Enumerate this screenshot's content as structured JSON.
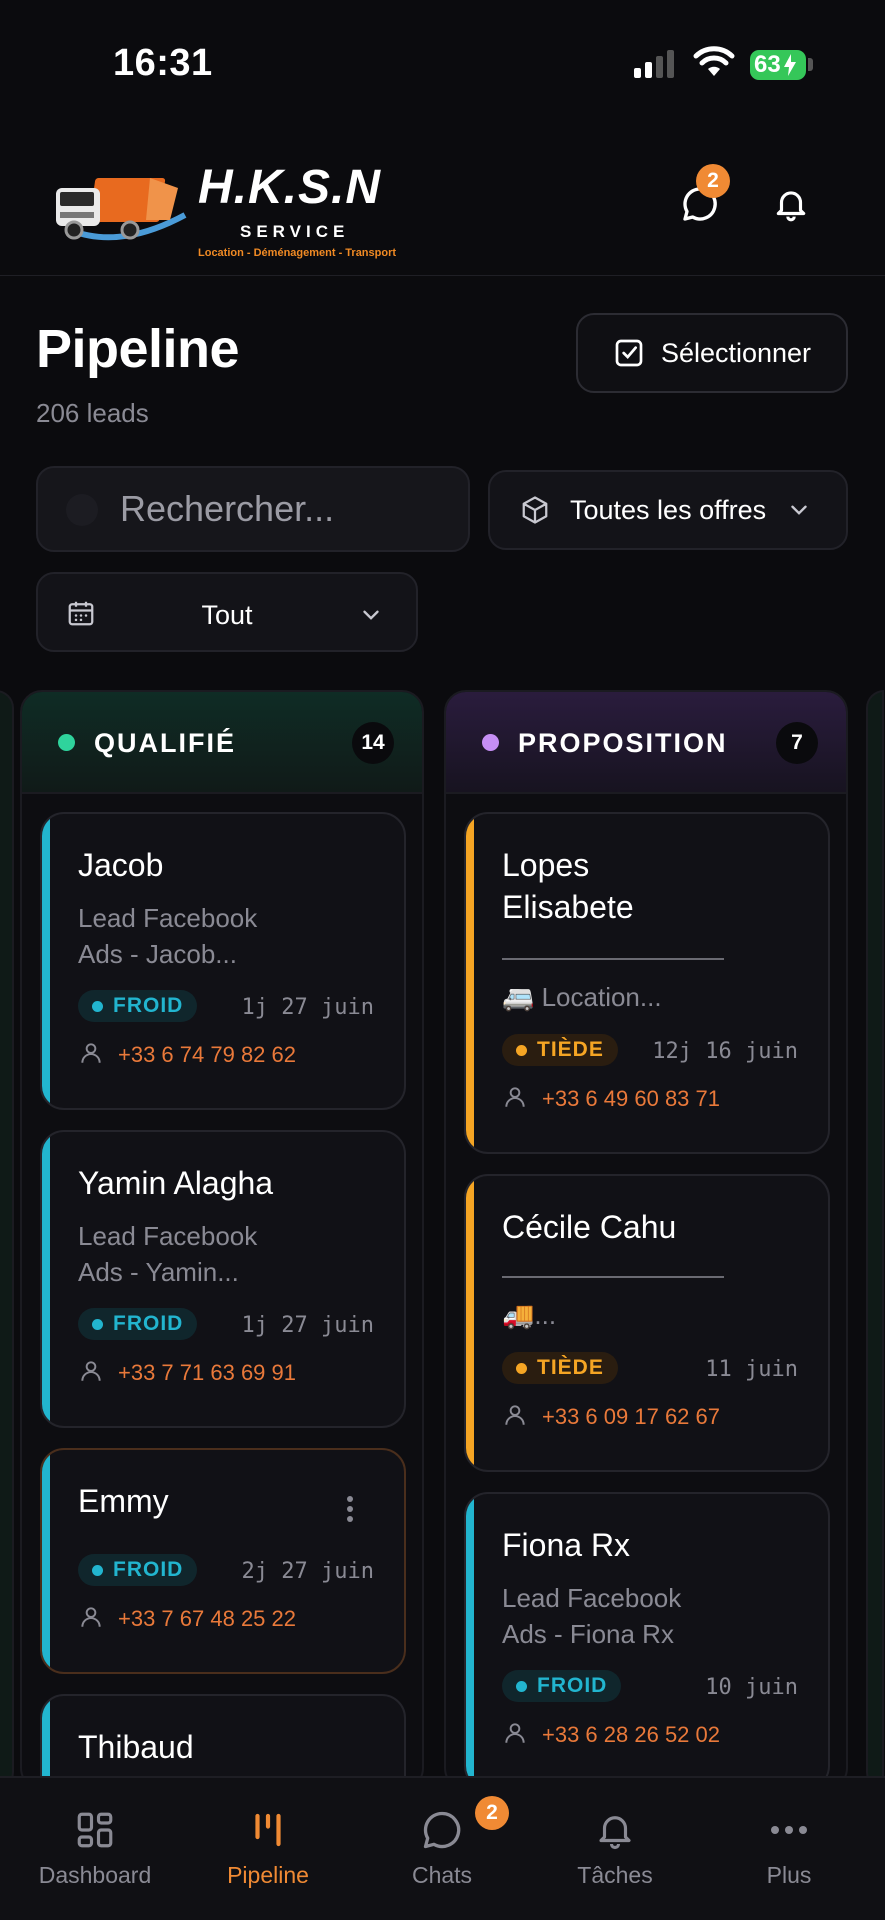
{
  "status_bar": {
    "time": "16:31",
    "battery": "63"
  },
  "header": {
    "logo": {
      "title": "H.K.S.N",
      "subtitle": "SERVICE",
      "tagline": "Location - Déménagement - Transport"
    },
    "chat_badge": "2"
  },
  "page": {
    "title": "Pipeline",
    "count": "206 leads",
    "select_label": "Sélectionner"
  },
  "filters": {
    "search_placeholder": "Rechercher...",
    "offers_label": "Toutes les offres",
    "period_label": "Tout"
  },
  "colors": {
    "accent": "#f08a34",
    "qualified": "#2fd39c",
    "proposal": "#c68ff5",
    "froid": "#22b5cf",
    "tiede": "#f5a524"
  },
  "columns": [
    {
      "title": "QUALIFIÉ",
      "count": "14",
      "cards": [
        {
          "name": "Jacob",
          "desc": "Lead Facebook Ads - Jacob...",
          "tag": "FROID",
          "meta": "1j 27 juin",
          "phone": "+33 6 74 79 82 62"
        },
        {
          "name": "Yamin Alagha",
          "desc": "Lead Facebook Ads - Yamin...",
          "tag": "FROID",
          "meta": "1j 27 juin",
          "phone": "+33 7 71 63 69 91"
        },
        {
          "name": "Emmy",
          "tag": "FROID",
          "meta": "2j 27 juin",
          "phone": "+33 7 67 48 25 22"
        },
        {
          "name": "Thibaud"
        }
      ]
    },
    {
      "title": "PROPOSITION",
      "count": "7",
      "cards": [
        {
          "name": "Lopes Elisabete",
          "offer": "🚐 Location...",
          "tag": "TIÈDE",
          "meta": "12j 16 juin",
          "phone": "+33 6 49 60 83 71"
        },
        {
          "name": "Cécile Cahu",
          "offer": "🚚...",
          "tag": "TIÈDE",
          "meta": "11 juin",
          "phone": "+33 6 09 17 62 67"
        },
        {
          "name": "Fiona Rx",
          "desc": "Lead Facebook Ads - Fiona Rx",
          "tag": "FROID",
          "meta": "10 juin",
          "phone": "+33 6 28 26 52 02"
        }
      ]
    }
  ],
  "nav": {
    "items": [
      "Dashboard",
      "Pipeline",
      "Chats",
      "Tâches",
      "Plus"
    ],
    "chats_badge": "2",
    "active": "Pipeline"
  }
}
